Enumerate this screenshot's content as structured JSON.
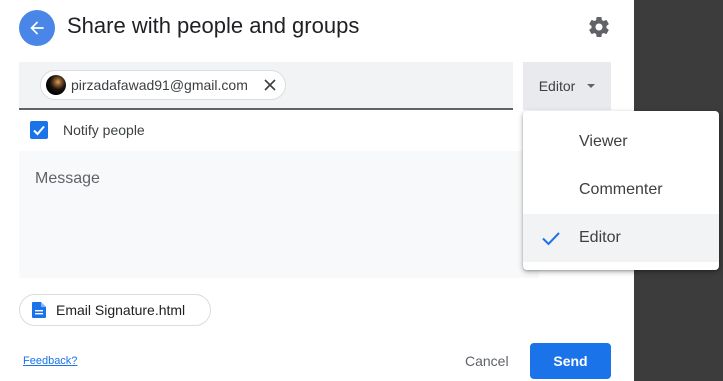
{
  "header": {
    "title": "Share with people and groups"
  },
  "recipients": {
    "chips": [
      {
        "email": "pirzadafawad91@gmail.com"
      }
    ]
  },
  "role": {
    "selected": "Editor"
  },
  "notify": {
    "label": "Notify people",
    "checked": true
  },
  "message": {
    "placeholder": "Message"
  },
  "attachment": {
    "name": "Email Signature.html"
  },
  "footer": {
    "feedback": "Feedback?",
    "cancel": "Cancel",
    "send": "Send"
  },
  "role_menu": {
    "items": [
      {
        "label": "Viewer",
        "selected": false
      },
      {
        "label": "Commenter",
        "selected": false
      },
      {
        "label": "Editor",
        "selected": true
      }
    ]
  },
  "colors": {
    "accent": "#1a73e8",
    "back_button": "#4a86e8",
    "side_panel": "#3c3c3c"
  },
  "icons": {
    "back": "arrow-left-icon",
    "settings": "gear-icon",
    "remove": "close-icon",
    "attachment": "document-icon",
    "checkmark": "check-icon"
  }
}
